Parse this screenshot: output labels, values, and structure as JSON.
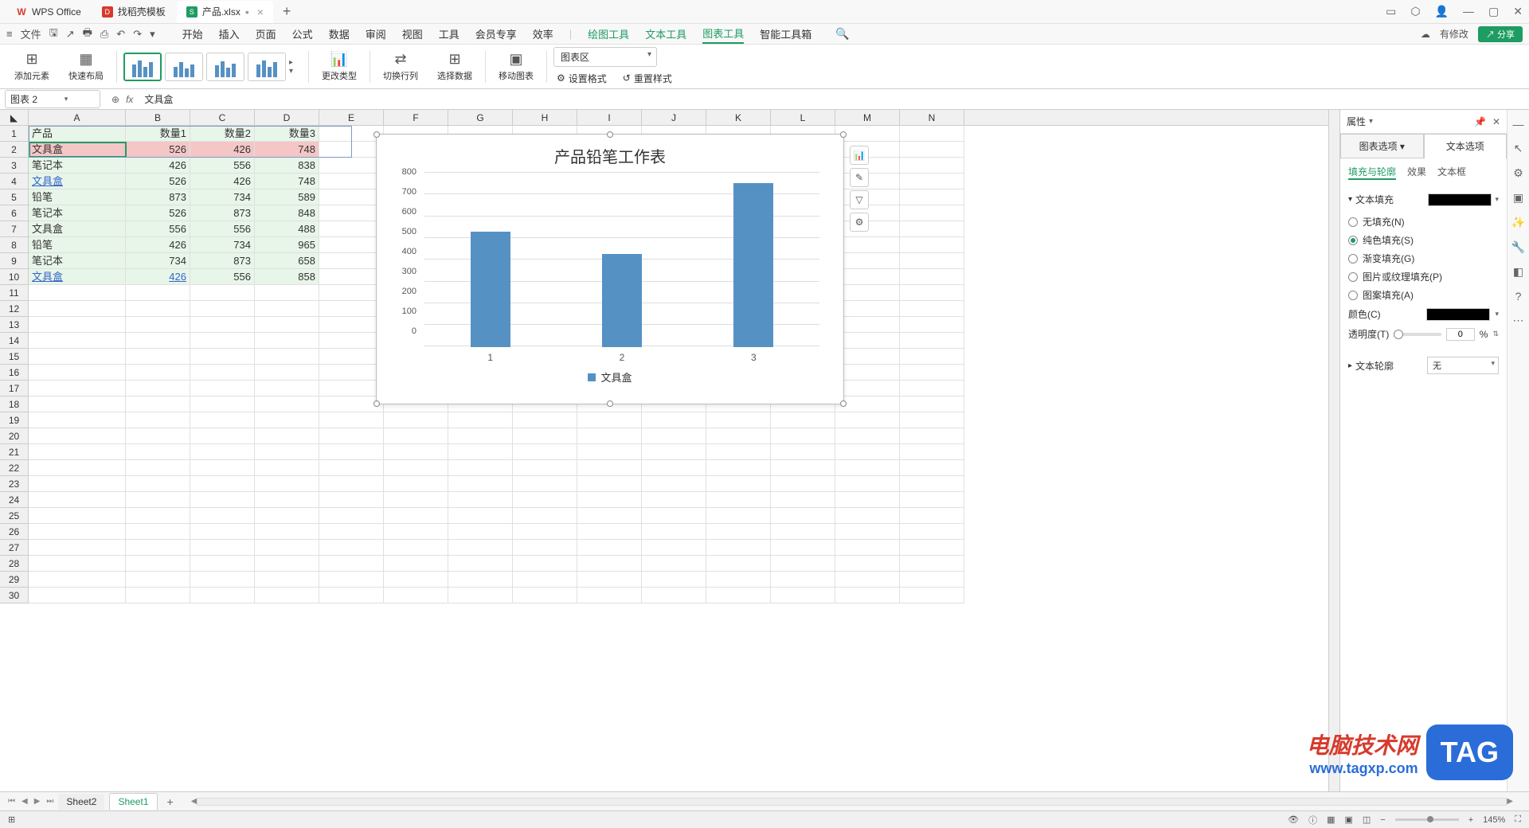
{
  "titlebar": {
    "tabs": [
      {
        "icon": "W",
        "label": "WPS Office"
      },
      {
        "icon": "D",
        "label": "找稻壳模板"
      },
      {
        "icon": "S",
        "label": "产品.xlsx",
        "dirty": true
      }
    ],
    "win": [
      "▢",
      "◈",
      "👤",
      "—",
      "▢",
      "✕"
    ]
  },
  "menubar": {
    "file": "文件",
    "tabs": [
      "开始",
      "插入",
      "页面",
      "公式",
      "数据",
      "审阅",
      "视图",
      "工具",
      "会员专享",
      "效率"
    ],
    "green_tabs": [
      "绘图工具",
      "文本工具",
      "图表工具",
      "智能工具箱"
    ],
    "active_tab": "图表工具",
    "has_modified": "有修改",
    "share": "分享"
  },
  "ribbon": {
    "add_element": "添加元素",
    "quick_layout": "快速布局",
    "change_type": "更改类型",
    "switch_rowcol": "切换行列",
    "select_data": "选择数据",
    "move_chart": "移动图表",
    "chart_area_select": "图表区",
    "set_format": "设置格式",
    "reset_style": "重置样式"
  },
  "formulabar": {
    "namebox": "图表 2",
    "formula": "文具盒"
  },
  "sheet": {
    "cols": [
      "A",
      "B",
      "C",
      "D",
      "E",
      "F",
      "G",
      "H",
      "I",
      "J",
      "K",
      "L",
      "M",
      "N"
    ],
    "headers": [
      "产品",
      "数量1",
      "数量2",
      "数量3"
    ],
    "rows": [
      [
        "文具盒",
        "526",
        "426",
        "748"
      ],
      [
        "笔记本",
        "426",
        "556",
        "838"
      ],
      [
        "文具盒",
        "526",
        "426",
        "748"
      ],
      [
        "铅笔",
        "873",
        "734",
        "589"
      ],
      [
        "笔记本",
        "526",
        "873",
        "848"
      ],
      [
        "文具盒",
        "556",
        "556",
        "488"
      ],
      [
        "铅笔",
        "426",
        "734",
        "965"
      ],
      [
        "笔记本",
        "734",
        "873",
        "658"
      ],
      [
        "文具盒",
        "426",
        "556",
        "858"
      ]
    ],
    "row_count": 30
  },
  "chart_data": {
    "type": "bar",
    "title": "产品铅笔工作表",
    "categories": [
      "1",
      "2",
      "3"
    ],
    "values": [
      526,
      426,
      748
    ],
    "series_name": "文具盒",
    "ylim": [
      0,
      800
    ],
    "yticks": [
      0,
      100,
      200,
      300,
      400,
      500,
      600,
      700,
      800
    ]
  },
  "panel": {
    "title": "属性",
    "main_tabs": [
      "图表选项",
      "文本选项"
    ],
    "active_main": "文本选项",
    "subtabs": [
      "填充与轮廓",
      "效果",
      "文本框"
    ],
    "active_sub": "填充与轮廓",
    "section_fill": "文本填充",
    "fills": [
      {
        "label": "无填充(N)"
      },
      {
        "label": "纯色填充(S)",
        "checked": true
      },
      {
        "label": "渐变填充(G)"
      },
      {
        "label": "图片或纹理填充(P)"
      },
      {
        "label": "图案填充(A)"
      }
    ],
    "color_label": "颜色(C)",
    "opacity_label": "透明度(T)",
    "opacity_value": "0",
    "opacity_unit": "%",
    "section_outline": "文本轮廓",
    "outline_value": "无"
  },
  "sheets": {
    "tabs": [
      "Sheet2",
      "Sheet1"
    ],
    "active": "Sheet1"
  },
  "statusbar": {
    "zoom": "145%"
  },
  "watermark": {
    "line1": "电脑技术网",
    "line2": "www.tagxp.com",
    "tag": "TAG"
  }
}
